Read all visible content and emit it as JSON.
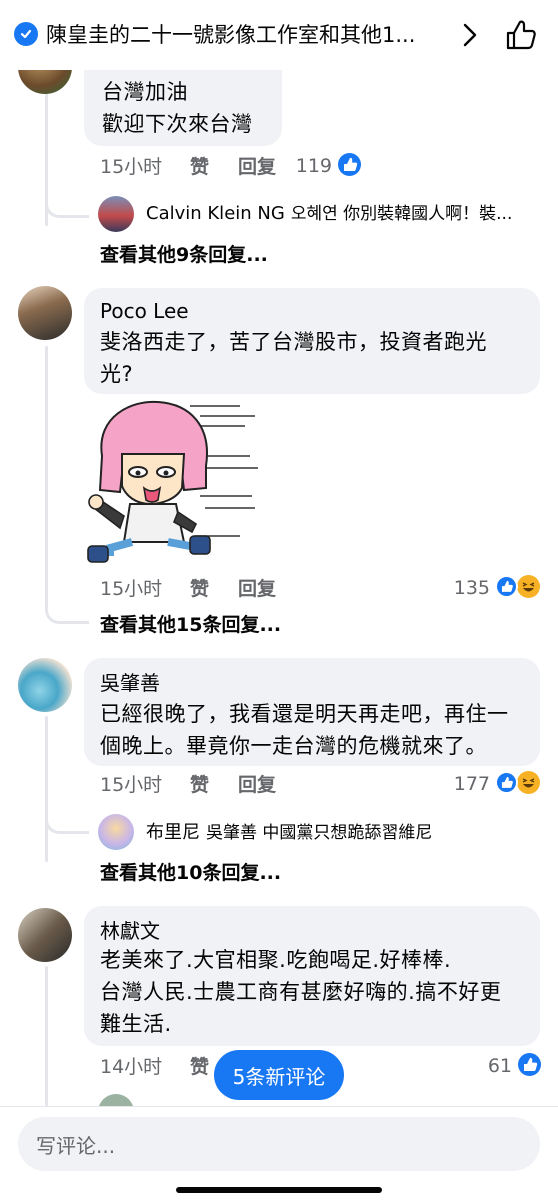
{
  "header": {
    "title": "陳皇圭的二十一號影像工作室和其他1...",
    "chevron_icon": "chevron-right-icon",
    "like_icon": "thumbs-up-outline-icon"
  },
  "comments": [
    {
      "author": "",
      "text_lines": [
        "台灣加油",
        "歡迎下次來台灣"
      ],
      "time": "15小时",
      "like_label": "赞",
      "reply_label": "回复",
      "reaction_count": "119",
      "reply_preview": {
        "name": "Calvin Klein NG",
        "text": "오혜연 你別裝韓國人啊！裝..."
      },
      "more_replies": "查看其他9条回复..."
    },
    {
      "author": "Poco Lee",
      "text_lines": [
        "斐洛西走了，苦了台灣股市，投資者跑光",
        "光?"
      ],
      "sticker": "running-girl-sticker",
      "time": "15小时",
      "like_label": "赞",
      "reply_label": "回复",
      "reaction_count": "135",
      "more_replies": "查看其他15条回复..."
    },
    {
      "author": "吳肇善",
      "text_lines": [
        "已經很晚了，我看還是明天再走吧，再住一",
        "個晚上。畢竟你一走台灣的危機就來了。"
      ],
      "time": "15小时",
      "like_label": "赞",
      "reply_label": "回复",
      "reaction_count": "177",
      "reply_preview": {
        "name": "布里尼",
        "text": "吳肇善 中國黨只想跪舔習維尼"
      },
      "more_replies": "查看其他10条回复..."
    },
    {
      "author": "林獻文",
      "text_lines": [
        "老美來了.大官相聚.吃飽喝足.好棒棒.",
        "台灣人民.士農工商有甚麼好嗨的.搞不好更",
        "難生活."
      ],
      "time": "14小时",
      "like_label": "赞",
      "reaction_count": "61"
    }
  ],
  "new_comments_pill": "5条新评论",
  "composer": {
    "placeholder": "写评论..."
  },
  "colors": {
    "accent": "#1877f2",
    "bubble": "#f0f2f5",
    "meta": "#65676b",
    "haha": "#f7b125"
  }
}
